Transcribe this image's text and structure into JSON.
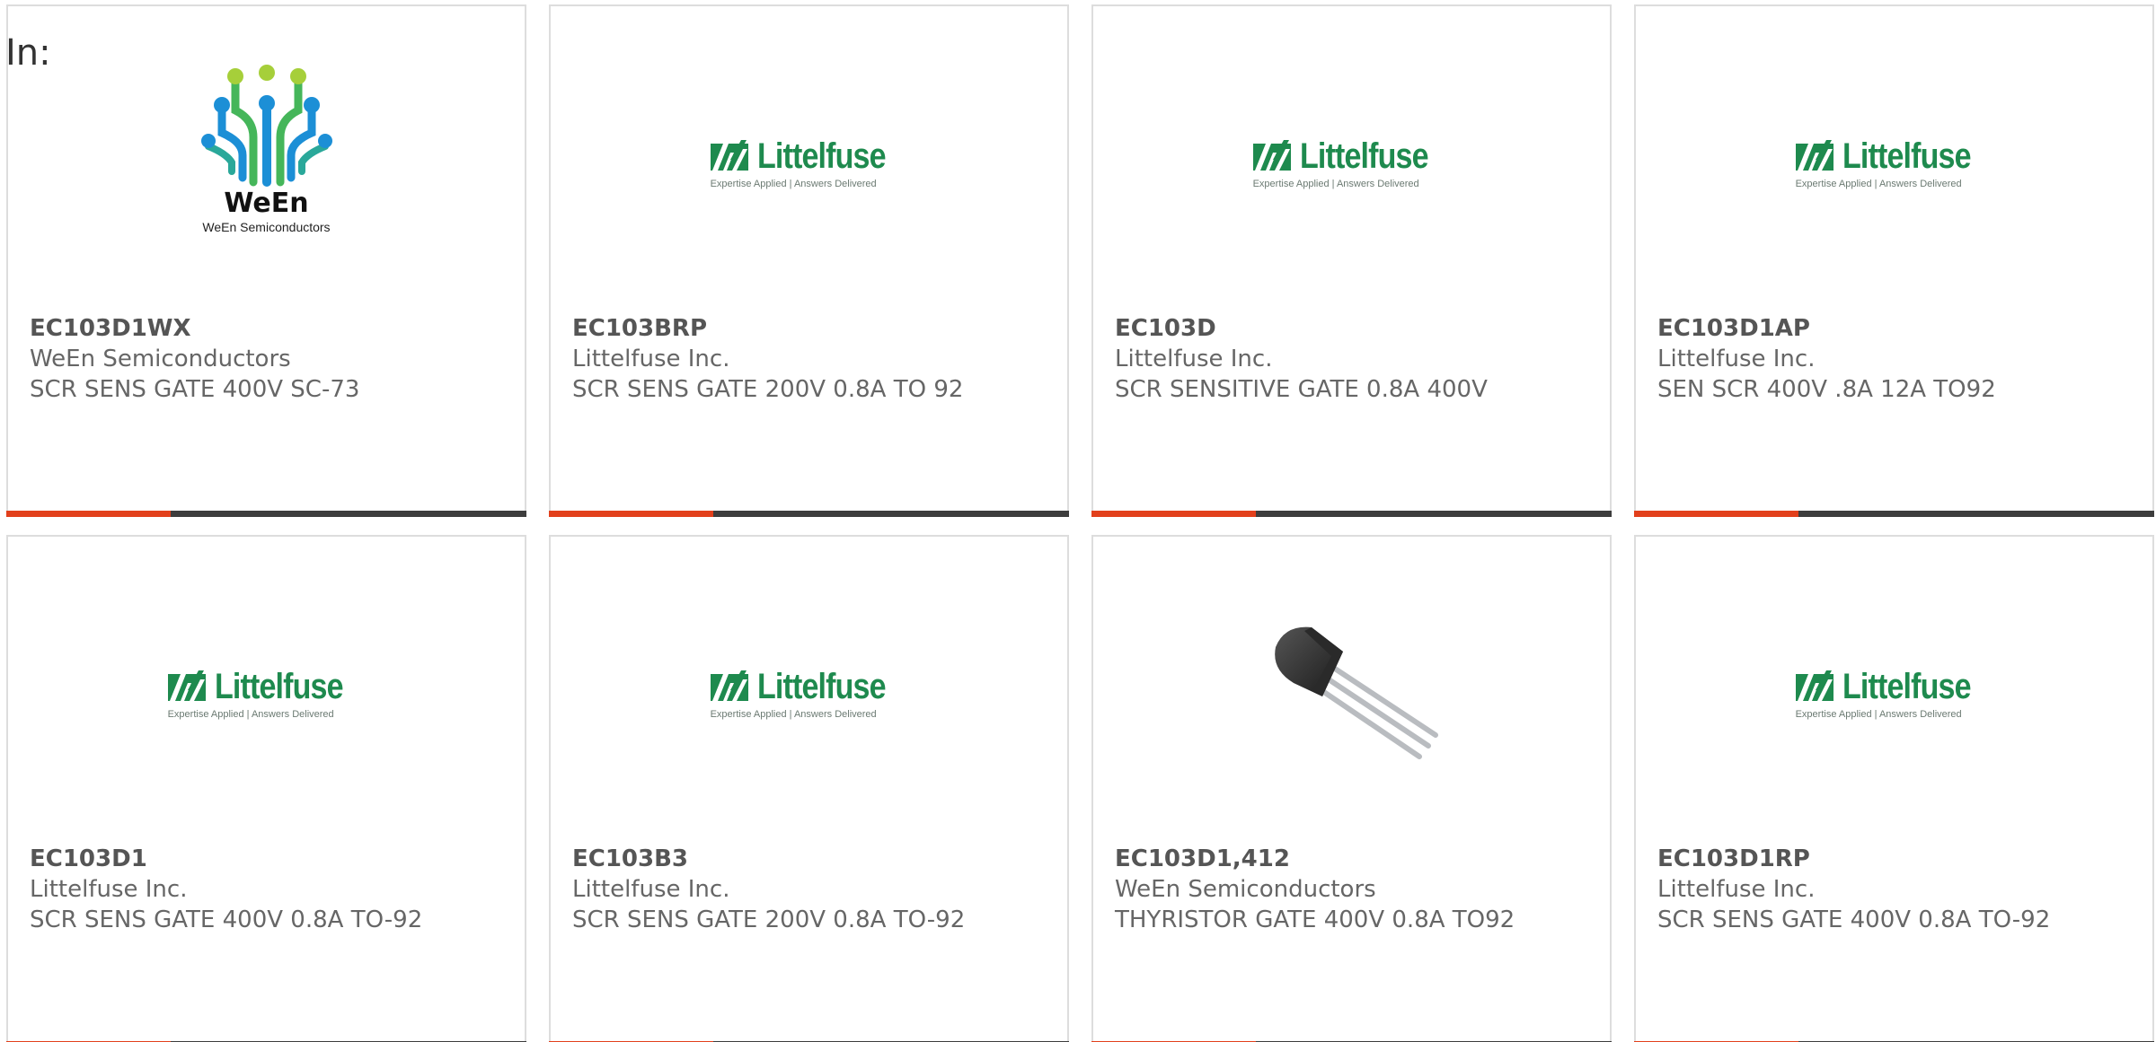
{
  "filter_label": "In:",
  "colors": {
    "accent": "#e2401c",
    "bar": "#3d3d3d",
    "littelfuse_green": "#1e8a4e",
    "ween_blue": "#1c8fd6",
    "ween_green": "#45b65a"
  },
  "products": [
    {
      "part": "EC103D1WX",
      "manufacturer": "WeEn Semiconductors",
      "description": "SCR SENS GATE 400V SC-73",
      "image": "ween-logo",
      "logo_name": "WeEn",
      "logo_sub": "WeEn Semiconductors"
    },
    {
      "part": "EC103BRP",
      "manufacturer": "Littelfuse Inc.",
      "description": "SCR SENS GATE 200V 0.8A TO 92",
      "image": "littelfuse-logo",
      "logo_name": "Littelfuse",
      "logo_tagline": "Expertise Applied | Answers Delivered"
    },
    {
      "part": "EC103D",
      "manufacturer": "Littelfuse Inc.",
      "description": "SCR SENSITIVE GATE 0.8A 400V",
      "image": "littelfuse-logo",
      "logo_name": "Littelfuse",
      "logo_tagline": "Expertise Applied | Answers Delivered"
    },
    {
      "part": "EC103D1AP",
      "manufacturer": "Littelfuse Inc.",
      "description": "SEN SCR 400V .8A 12A TO92",
      "image": "littelfuse-logo",
      "logo_name": "Littelfuse",
      "logo_tagline": "Expertise Applied | Answers Delivered"
    },
    {
      "part": "EC103D1",
      "manufacturer": "Littelfuse Inc.",
      "description": "SCR SENS GATE 400V 0.8A TO-92",
      "image": "littelfuse-logo",
      "logo_name": "Littelfuse",
      "logo_tagline": "Expertise Applied | Answers Delivered"
    },
    {
      "part": "EC103B3",
      "manufacturer": "Littelfuse Inc.",
      "description": "SCR SENS GATE 200V 0.8A TO-92",
      "image": "littelfuse-logo",
      "logo_name": "Littelfuse",
      "logo_tagline": "Expertise Applied | Answers Delivered"
    },
    {
      "part": "EC103D1,412",
      "manufacturer": "WeEn Semiconductors",
      "description": "THYRISTOR GATE 400V 0.8A TO92",
      "image": "to92-package-photo"
    },
    {
      "part": "EC103D1RP",
      "manufacturer": "Littelfuse Inc.",
      "description": "SCR SENS GATE 400V 0.8A TO-92",
      "image": "littelfuse-logo",
      "logo_name": "Littelfuse",
      "logo_tagline": "Expertise Applied | Answers Delivered"
    }
  ]
}
